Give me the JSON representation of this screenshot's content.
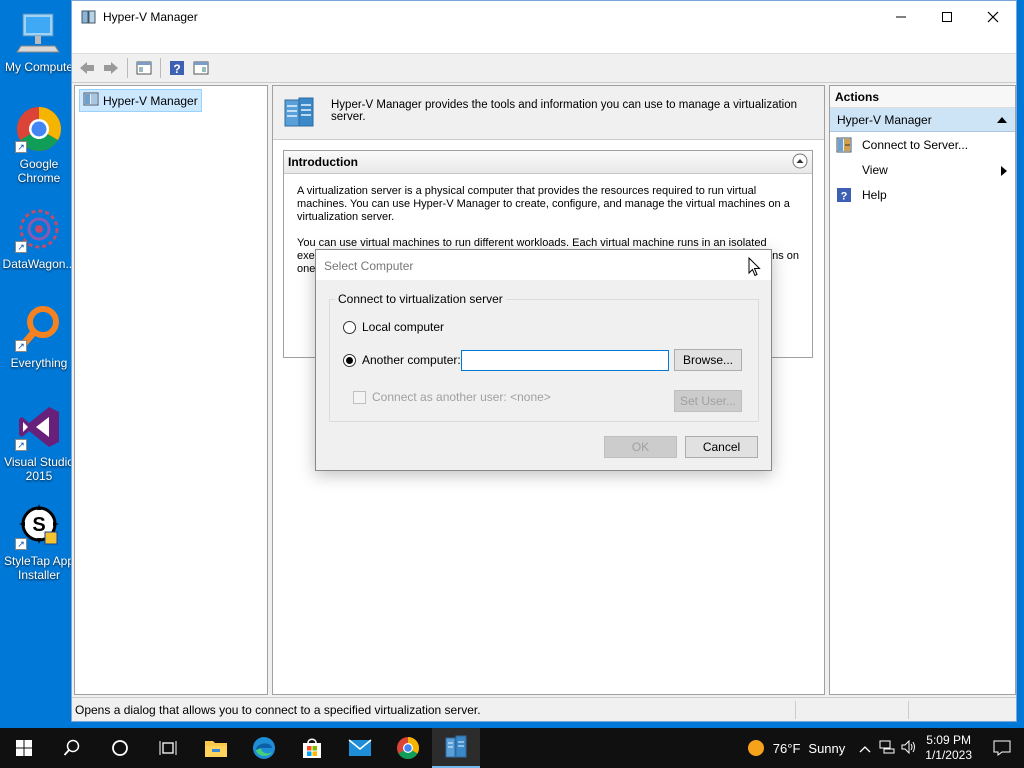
{
  "desktop": {
    "icons": [
      {
        "label": "My Compute"
      },
      {
        "label": "Google Chrome"
      },
      {
        "label": "DataWagon..."
      },
      {
        "label": "Everything"
      },
      {
        "label": "Visual Studio 2015"
      },
      {
        "label": "StyleTap App Installer"
      }
    ]
  },
  "window": {
    "title": "Hyper-V Manager",
    "tree": {
      "root_label": "Hyper-V Manager"
    },
    "info_text": "Hyper-V Manager provides the tools and information you can use to manage a virtualization server.",
    "intro": {
      "heading": "Introduction",
      "para1": "A virtualization server is a physical computer that provides the resources required to run virtual machines. You can use Hyper-V Manager to create, configure, and manage the virtual machines on a virtualization server.",
      "para2": "You can use virtual machines to run different workloads. Each virtual machine runs in an isolated",
      "para2_line2_start": "exec",
      "para2_line2_end": "ns on",
      "para2_line3_start": "one"
    },
    "actions": {
      "title": "Actions",
      "section": "Hyper-V Manager",
      "items": [
        {
          "label": "Connect to Server..."
        },
        {
          "label": "View"
        },
        {
          "label": "Help"
        }
      ]
    },
    "status": "Opens a dialog that allows you to connect to a specified virtualization server."
  },
  "dialog": {
    "title": "Select Computer",
    "group_label": "Connect to virtualization server",
    "local_label": "Local computer",
    "another_label": "Another computer:",
    "another_value": "",
    "selected": "another",
    "browse_label": "Browse...",
    "connect_as_label": "Connect as another user: <none>",
    "set_user_label": "Set User...",
    "ok_label": "OK",
    "cancel_label": "Cancel"
  },
  "taskbar": {
    "weather": {
      "temp": "76°F",
      "condition": "Sunny"
    },
    "clock": {
      "time": "5:09 PM",
      "date": "1/1/2023"
    }
  }
}
